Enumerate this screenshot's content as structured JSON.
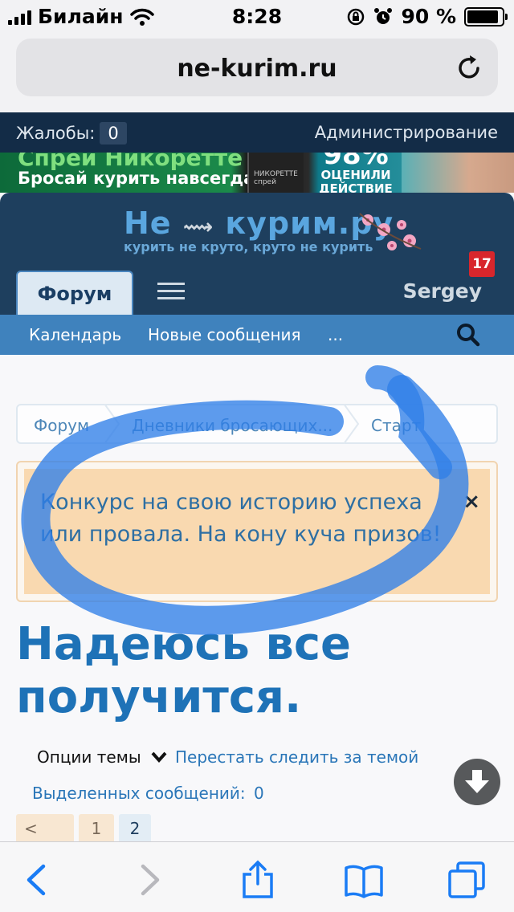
{
  "status_bar": {
    "carrier": "Билайн",
    "time": "8:28",
    "battery": "90 %",
    "battery_level": 0.9
  },
  "browser": {
    "url": "ne-kurim.ru"
  },
  "admin_bar": {
    "complaints_label": "Жалобы:",
    "complaints_count": "0",
    "admin_link": "Администрирование"
  },
  "ad": {
    "line1": "Спрей Никоретте",
    "line2": "Бросай курить навсегда!",
    "pack_text": "НИКОРЕТТЕ спрей",
    "badge_big": "98%",
    "badge_small": "ОЦЕНИЛИ ДЕЙСТВИЕ"
  },
  "header": {
    "logo_main_a": "Не",
    "logo_main_b": "курим.ру",
    "logo_sub": "курить не круто, круто не курить",
    "forum_tab": "Форум",
    "user_name": "Sergey",
    "alerts_count": "17"
  },
  "subnav": {
    "items": [
      "Календарь",
      "Новые сообщения",
      "..."
    ]
  },
  "breadcrumb": {
    "items": [
      "Форум",
      "Дневники бросающих...",
      "Старт"
    ]
  },
  "notice": {
    "text": "Конкурс на свою историю успеха или провала. На кону куча призов!",
    "close": "×"
  },
  "thread": {
    "title": "Надеюсь все получится.",
    "options_label": "Опции темы",
    "unwatch_label": "Перестать следить за темой",
    "selected_label": "Выделенных сообщений:",
    "selected_count": "0"
  },
  "pager": {
    "prev": "<",
    "pages": [
      "1",
      "2"
    ]
  },
  "icons": {
    "back": "chevron-left-icon",
    "forward": "chevron-right-icon",
    "share": "share-icon",
    "bookmarks": "book-icon",
    "tabs": "tabs-icon",
    "reload": "reload-icon",
    "search": "search-icon",
    "scroll": "arrow-down-icon"
  },
  "colors": {
    "admin_bar": "#132c47",
    "header": "#1e3f5e",
    "subnav": "#3f82bd",
    "link": "#2a76b8",
    "title": "#1e72b7",
    "notice_bg": "#f9d9b0",
    "alert_badge": "#d8262c",
    "ios_blue": "#1a7cf5",
    "marker": "#2f7fe8"
  }
}
